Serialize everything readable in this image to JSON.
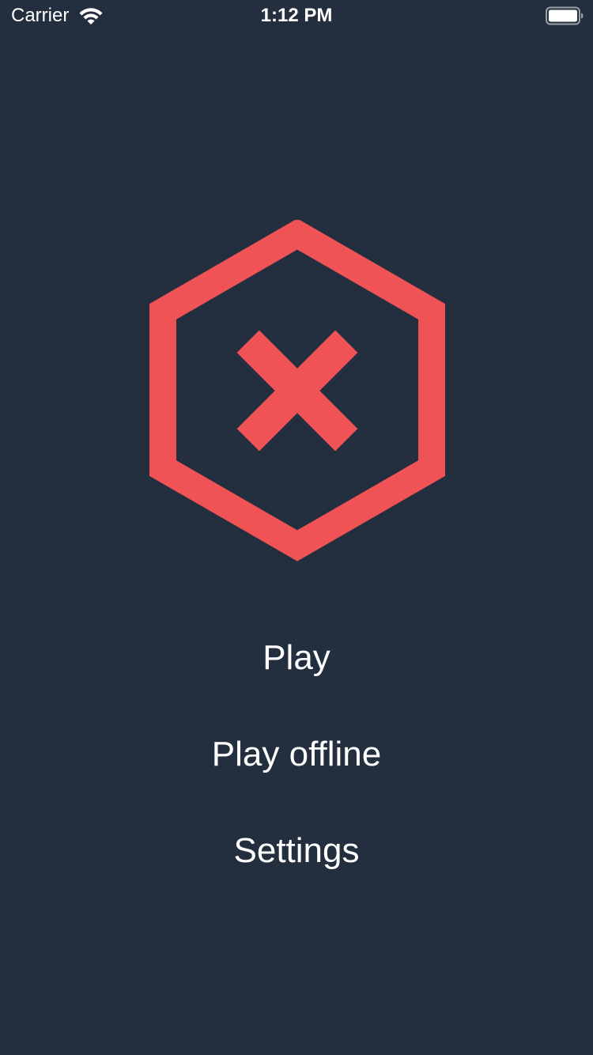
{
  "theme": {
    "background": "#232e3e",
    "accent": "#f05355",
    "text": "#ffffff"
  },
  "status_bar": {
    "carrier": "Carrier",
    "time": "1:12 PM",
    "wifi_icon": "wifi-icon",
    "battery_icon": "battery-full-icon"
  },
  "logo": {
    "icon": "hexagon-x-icon"
  },
  "menu": {
    "play_label": "Play",
    "play_offline_label": "Play offline",
    "settings_label": "Settings"
  }
}
